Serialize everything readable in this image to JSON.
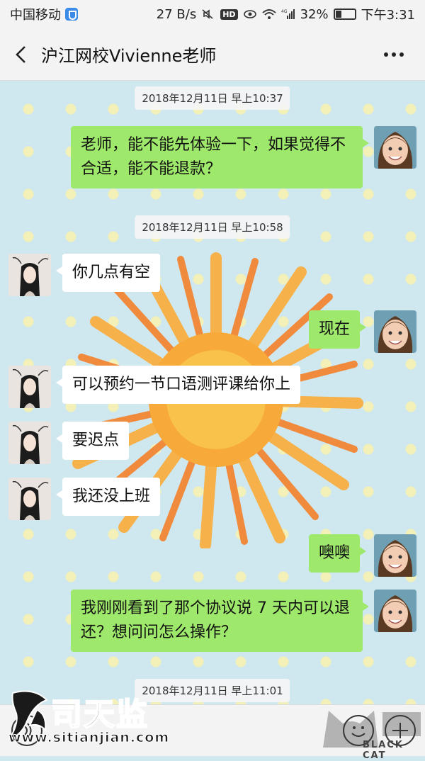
{
  "status_bar": {
    "carrier": "中国移动",
    "speed": "27 B/s",
    "hd": "HD",
    "network": "4G",
    "battery": "32%",
    "time": "下午3:31"
  },
  "nav": {
    "title": "沪江网校Vivienne老师"
  },
  "messages": {
    "ts1": "2018年12月11日 早上10:37",
    "m1": "老师，能不能先体验一下，如果觉得不合适，能不能退款？",
    "ts2": "2018年12月11日 早上10:58",
    "m2": "你几点有空",
    "m3": "现在",
    "m4": "可以预约一节口语测评课给你上",
    "m5": "要迟点",
    "m6": "我还没上班",
    "m7": "噢噢",
    "m8": "我刚刚看到了那个协议说 7 天内可以退还？想问问怎么操作？",
    "ts3": "2018年12月11日 早上11:01"
  },
  "watermark": {
    "brand": "司天监",
    "url": "www.sitianjian.com",
    "black_cat": "BLACK CAT"
  },
  "colors": {
    "my_bubble": "#9ee86b",
    "their_bubble": "#ffffff",
    "chat_bg": "#cfe7ee"
  }
}
